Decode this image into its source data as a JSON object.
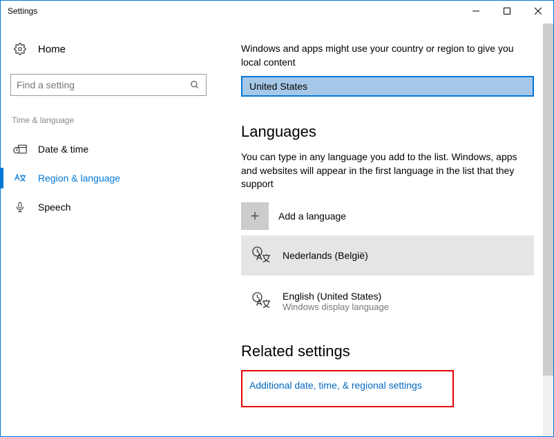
{
  "window": {
    "title": "Settings"
  },
  "sidebar": {
    "home": "Home",
    "search_placeholder": "Find a setting",
    "section_label": "Time & language",
    "items": [
      {
        "label": "Date & time"
      },
      {
        "label": "Region & language"
      },
      {
        "label": "Speech"
      }
    ]
  },
  "main": {
    "region_intro": "Windows and apps might use your country or region to give you local content",
    "region_value": "United States",
    "lang_heading": "Languages",
    "lang_desc": "You can type in any language you add to the list. Windows, apps and websites will appear in the first language in the list that they support",
    "add_lang": "Add a language",
    "languages": [
      {
        "name": "Nederlands (België)",
        "sub": ""
      },
      {
        "name": "English (United States)",
        "sub": "Windows display language"
      }
    ],
    "related_heading": "Related settings",
    "related_link": "Additional date, time, & regional settings"
  }
}
